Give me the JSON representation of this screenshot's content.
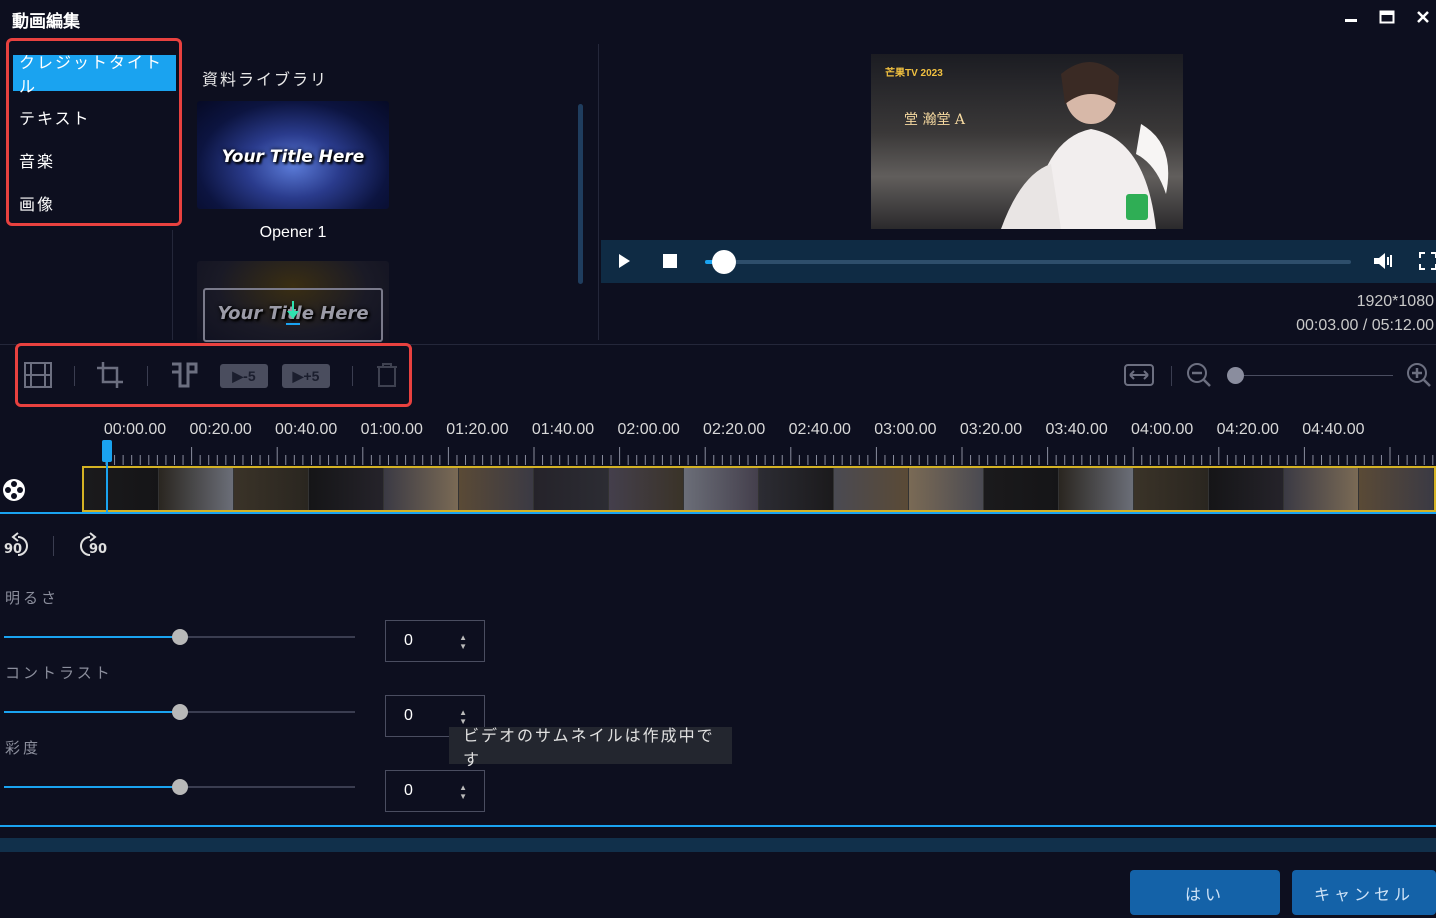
{
  "window": {
    "title": "動画編集",
    "controls": {
      "minimize": "minimize-icon",
      "maximize": "maximize-icon",
      "close": "close-icon"
    }
  },
  "categories": [
    {
      "label": "クレジットタイトル",
      "active": true
    },
    {
      "label": "テキスト",
      "active": false
    },
    {
      "label": "音楽",
      "active": false
    },
    {
      "label": "画像",
      "active": false
    }
  ],
  "library": {
    "title": "資料ライブラリ",
    "items": [
      {
        "thumb_text": "Your Title Here",
        "label": "Opener 1"
      },
      {
        "thumb_text": "Your Title Here",
        "label": ""
      }
    ]
  },
  "preview": {
    "logo_text": "芒果TV 2023",
    "subtitle": "堂 瀚堂 A",
    "resolution": "1920*1080",
    "time": "00:03.00 / 05:12.00",
    "progress": 0.03
  },
  "toolbar": {
    "skip_back_label": "▶-5",
    "skip_forward_label": "▶+5",
    "zoom_level": 0.05
  },
  "timeline": {
    "ticks": [
      "00:00.00",
      "00:20.00",
      "00:40.00",
      "01:00.00",
      "01:20.00",
      "01:40.00",
      "02:00.00",
      "02:20.00",
      "02:40.00",
      "03:00.00",
      "03:20.00",
      "03:40.00",
      "04:00.00",
      "04:20.00",
      "04:40.00"
    ],
    "playhead_time": "00:03.00"
  },
  "adjustments": {
    "rotate_left_label": "90",
    "rotate_right_label": "90",
    "items": [
      {
        "label": "明るさ",
        "value": "0",
        "level": 0.5
      },
      {
        "label": "コントラスト",
        "value": "0",
        "level": 0.5
      },
      {
        "label": "彩度",
        "value": "0",
        "level": 0.5
      }
    ]
  },
  "tooltip": "ビデオのサムネイルは作成中です",
  "buttons": {
    "ok": "はい",
    "cancel": "キャンセル"
  },
  "colors": {
    "accent": "#1aa3f0",
    "highlight": "#e8413f",
    "background": "#0d0f1f"
  }
}
